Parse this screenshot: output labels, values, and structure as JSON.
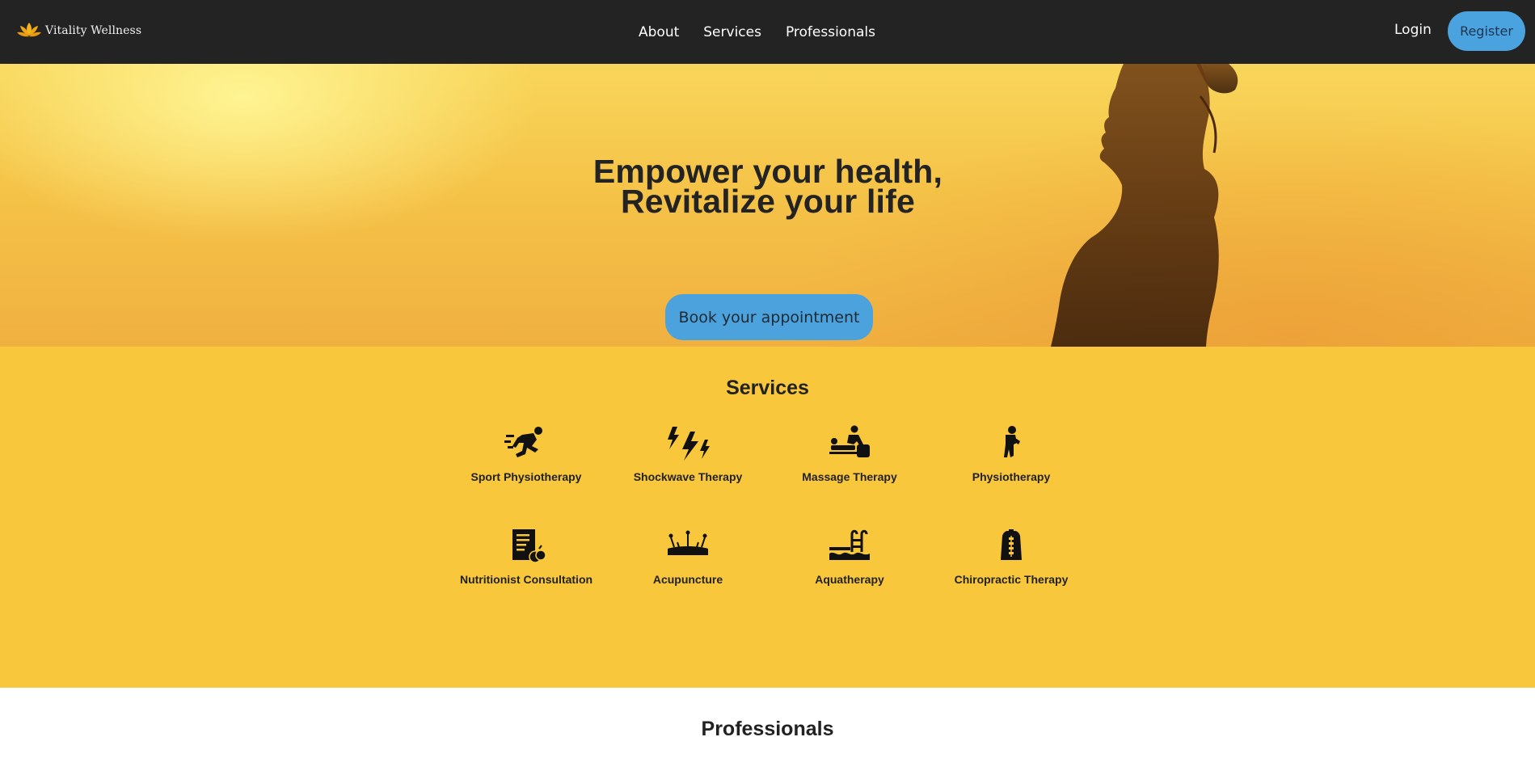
{
  "brand": {
    "name": "Vitality Wellness",
    "logo_icon": "lotus-icon",
    "logo_color": "#f4b41a"
  },
  "nav": {
    "links": [
      "About",
      "Services",
      "Professionals"
    ],
    "login": "Login",
    "register": "Register"
  },
  "hero": {
    "title_line1": "Empower your health,",
    "title_line2": "Revitalize your life",
    "cta": "Book your appointment",
    "background_colors": [
      "#f8d65a",
      "#f0b040"
    ]
  },
  "services": {
    "title": "Services",
    "items": [
      {
        "label": "Sport Physiotherapy",
        "icon": "runner-icon"
      },
      {
        "label": "Shockwave Therapy",
        "icon": "lightning-icon"
      },
      {
        "label": "Massage Therapy",
        "icon": "massage-icon"
      },
      {
        "label": "Physiotherapy",
        "icon": "injured-person-icon"
      },
      {
        "label": "Nutritionist Consultation",
        "icon": "diet-plan-icon"
      },
      {
        "label": "Acupuncture",
        "icon": "acupuncture-needles-icon"
      },
      {
        "label": "Aquatherapy",
        "icon": "pool-ladder-icon"
      },
      {
        "label": "Chiropractic Therapy",
        "icon": "spine-icon"
      }
    ],
    "background_color": "#f8c73c"
  },
  "professionals": {
    "title": "Professionals"
  },
  "colors": {
    "navbar": "#232323",
    "accent_button": "#4aa3df"
  }
}
